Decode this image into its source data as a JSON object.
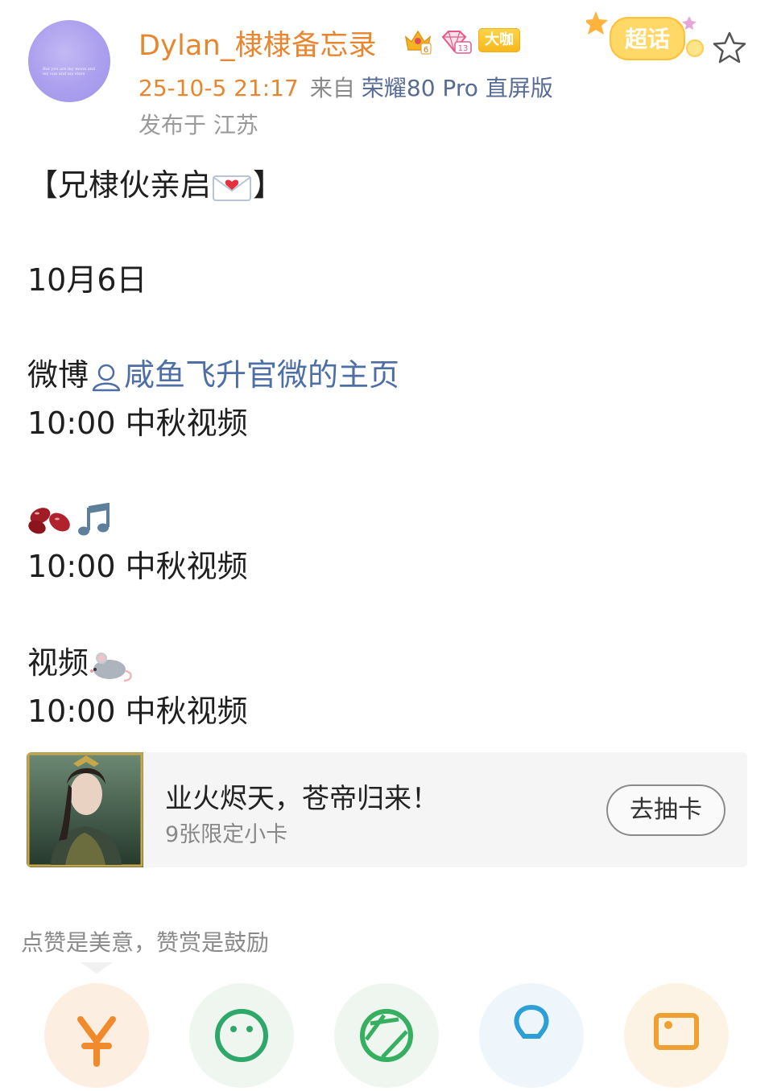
{
  "post": {
    "author": "Dylan_棣棣备忘录",
    "badges": {
      "vip": "大咖",
      "level_gem": "13",
      "crown_level": "6"
    },
    "time": "25-10-5 21:17",
    "from_label": "来自",
    "device": "荣耀80 Pro 直屏版",
    "location": "发布于 江苏",
    "supertopic_label": "超话",
    "avatar_text": "But you are my moon and my sun and my stars",
    "body": {
      "heading": "【兄棣伙亲启",
      "heading_end": "】",
      "date": "10月6日",
      "sections": [
        {
          "platform": "微博",
          "link": "咸鱼飞升官微的主页",
          "time_line": "10:00  中秋视频"
        },
        {
          "platform": "",
          "time_line": "10:00  中秋视频"
        },
        {
          "platform": "视频",
          "time_line": "10:00  中秋视频"
        }
      ]
    }
  },
  "card": {
    "title": "业火烬天，苍帝归来！",
    "subtitle": "9张限定小卡",
    "button": "去抽卡"
  },
  "reward": {
    "text": "点赞是美意，赞赏是鼓励"
  },
  "colors": {
    "author": "#e8862f",
    "link": "#4e6ea6",
    "meta_gray": "#8a8a8a"
  }
}
